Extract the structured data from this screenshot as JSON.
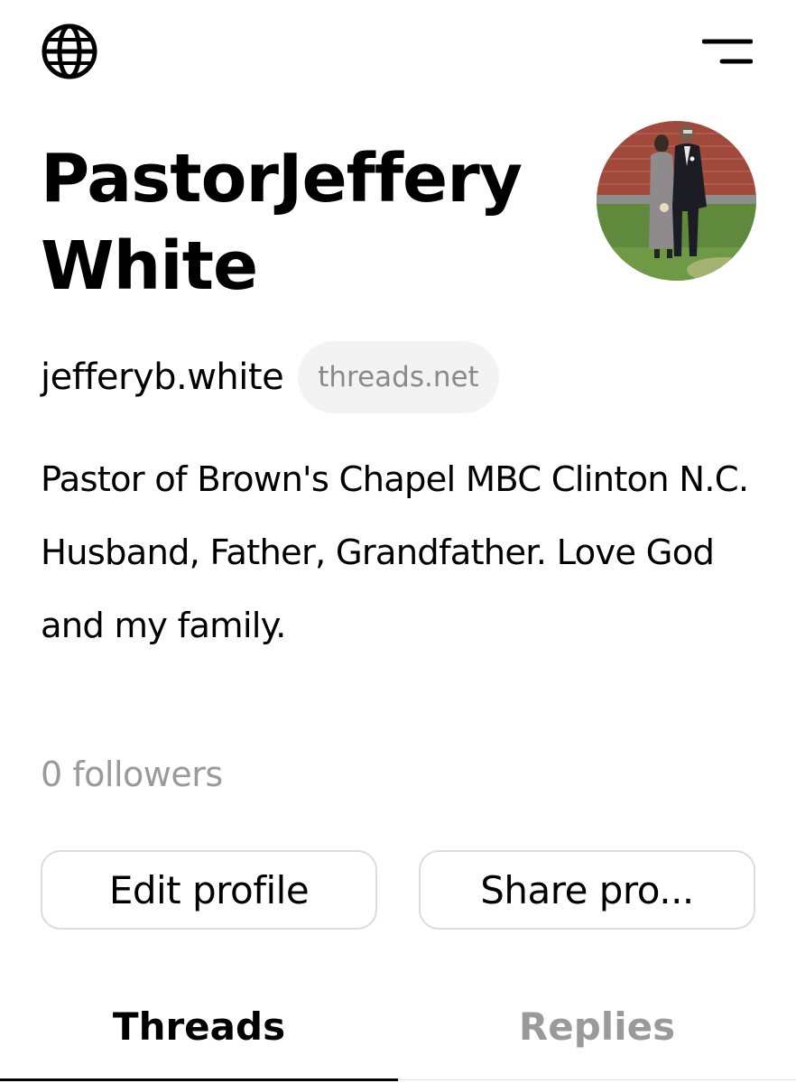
{
  "header": {
    "globe_icon": "globe-icon",
    "menu_icon": "menu-icon"
  },
  "profile": {
    "name": "PastorJeffery White",
    "handle": "jefferyb.white",
    "domain": "threads.net",
    "bio": "Pastor of Brown's Chapel MBC Clinton N.C. Husband, Father, Grandfather. Love God and my family.",
    "followers": "0 followers"
  },
  "actions": {
    "edit_label": "Edit profile",
    "share_label": "Share pro..."
  },
  "tabs": [
    {
      "label": "Threads",
      "active": true
    },
    {
      "label": "Replies",
      "active": false
    }
  ],
  "colors": {
    "text": "#000000",
    "muted": "#9a9a9a",
    "pill_bg": "#f3f3f3",
    "border": "#dcdcdc"
  }
}
